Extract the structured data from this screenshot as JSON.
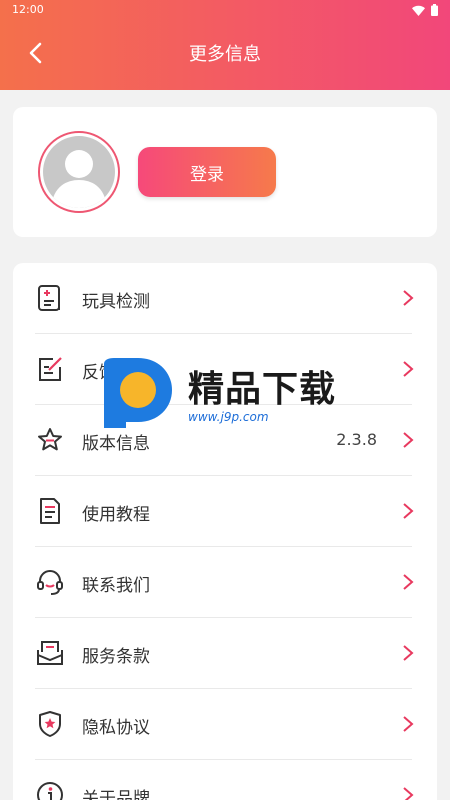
{
  "status_bar": {
    "time": "12:00"
  },
  "header": {
    "title": "更多信息"
  },
  "profile": {
    "login_label": "登录"
  },
  "menu": [
    {
      "label": "玩具检测",
      "icon": "toy-check-icon",
      "value": ""
    },
    {
      "label": "反馈",
      "icon": "feedback-icon",
      "value": ""
    },
    {
      "label": "版本信息",
      "icon": "version-star-icon",
      "value": "2.3.8"
    },
    {
      "label": "使用教程",
      "icon": "tutorial-document-icon",
      "value": ""
    },
    {
      "label": "联系我们",
      "icon": "headset-icon",
      "value": ""
    },
    {
      "label": "服务条款",
      "icon": "terms-envelope-icon",
      "value": ""
    },
    {
      "label": "隐私协议",
      "icon": "privacy-shield-icon",
      "value": ""
    },
    {
      "label": "关于品牌",
      "icon": "info-icon",
      "value": ""
    }
  ],
  "watermark": {
    "title": "精品下载",
    "url": "www.j9p.com"
  },
  "colors": {
    "header_start": "#f4704b",
    "header_end": "#f2477a",
    "accent": "#e8395f"
  }
}
